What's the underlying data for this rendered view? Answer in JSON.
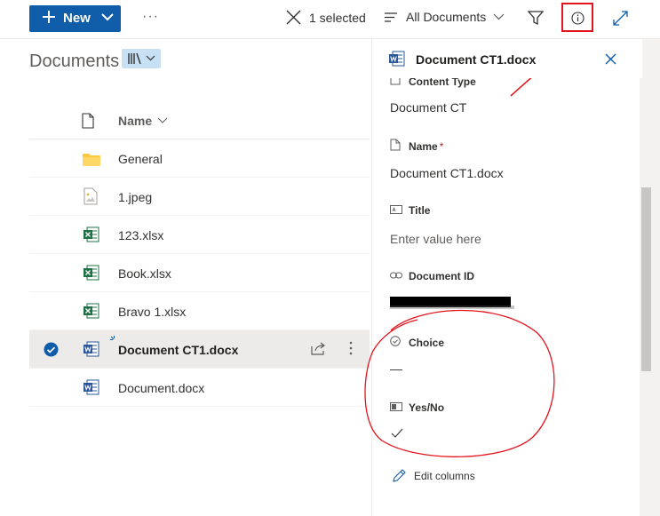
{
  "commandbar": {
    "new_label": "New",
    "more_label": "···",
    "selected_label": "1 selected",
    "view_label": "All Documents"
  },
  "library": {
    "title": "Documents",
    "column_header": "Name",
    "items": [
      {
        "name": "General",
        "icon": "folder-icon"
      },
      {
        "name": "1.jpeg",
        "icon": "image-file-icon"
      },
      {
        "name": "123.xlsx",
        "icon": "excel-file-icon"
      },
      {
        "name": "Book.xlsx",
        "icon": "excel-file-icon"
      },
      {
        "name": "Bravo 1.xlsx",
        "icon": "excel-file-icon"
      },
      {
        "name": "Document CT1.docx",
        "icon": "word-file-icon",
        "selected": true
      },
      {
        "name": "Document.docx",
        "icon": "word-file-icon"
      }
    ]
  },
  "details_pane": {
    "title": "Document CT1.docx",
    "fields": {
      "content_type_label": "Content Type",
      "content_type_value": "Document CT",
      "name_label": "Name",
      "name_required_mark": "*",
      "name_value": "Document CT1.docx",
      "title_label": "Title",
      "title_placeholder": "Enter value here",
      "document_id_label": "Document ID",
      "choice_label": "Choice",
      "choice_value": "—",
      "yesno_label": "Yes/No"
    },
    "edit_columns_label": "Edit columns"
  },
  "colors": {
    "accent": "#0f5ca8",
    "annotation_red": "#e3141d",
    "excel_green": "#1e7145",
    "word_blue": "#2b579a",
    "folder_yellow": "#ffc83d"
  }
}
